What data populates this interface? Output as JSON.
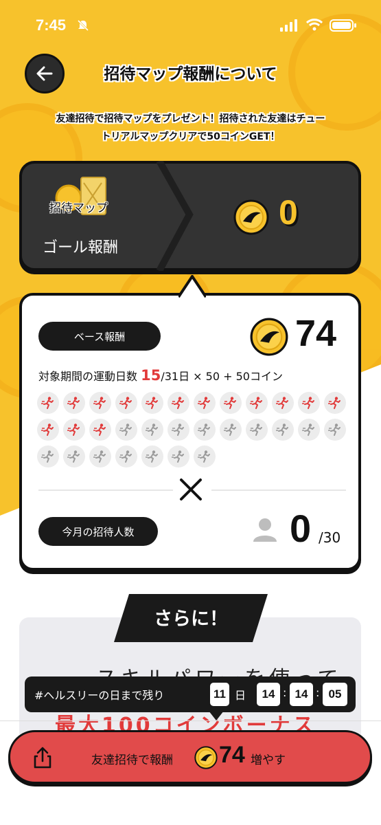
{
  "status_bar": {
    "time": "7:45"
  },
  "header": {
    "title": "招待マップ報酬について"
  },
  "intro": {
    "line1": "友達招待で招待マップをプレゼント！招待された友達はチュー",
    "line2": "トリアルマップクリアで50コインGET！"
  },
  "goal": {
    "map_label": "招待マップ",
    "label": "ゴール報酬",
    "value": "0"
  },
  "base": {
    "label": "ベース報酬",
    "value": "74",
    "formula_prefix": "対象期間の運動日数",
    "days": "15",
    "formula_suffix": "/31日 × 50 + 50コイン",
    "active_days": 15,
    "total_days": 31,
    "active_color": "#e13a3a",
    "inactive_color": "#9a9a9a"
  },
  "invite": {
    "label": "今月の招待人数",
    "value": "0",
    "total": "/30"
  },
  "more": {
    "title": "さらに！",
    "faded_line1": "スキルパワーを使って",
    "faded_line2": "最大100コインボーナス"
  },
  "countdown": {
    "label": "#ヘルスリーの日まで残り",
    "days": "11",
    "day_unit": "日",
    "hours": "14",
    "minutes": "14",
    "seconds": "05"
  },
  "cta": {
    "label": "友達招待で報酬",
    "value": "74",
    "suffix": "増やす"
  },
  "colors": {
    "accent_yellow": "#f7c22c",
    "cta_red": "#e14b4b",
    "dark": "#1a1a1a"
  }
}
